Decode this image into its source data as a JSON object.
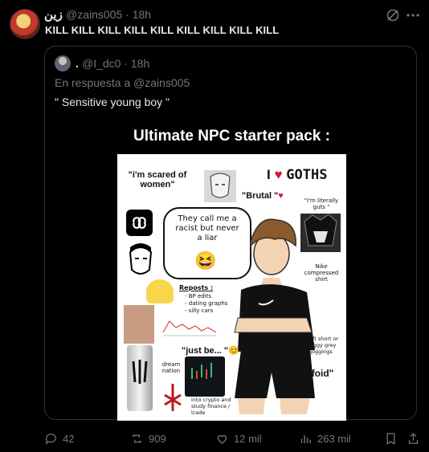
{
  "post": {
    "display_name": "زين",
    "handle_time": "@zains005 · 18h",
    "text": "KILL KILL KILL KILL KILL KILL KILL KILL KILL"
  },
  "quote": {
    "display_name": ".",
    "handle_time": "@I_dc0 · 18h",
    "reply_to": "En respuesta a @zains005",
    "text": "\" Sensitive young boy \"",
    "meme": {
      "title": "Ultimate NPC starter pack :",
      "scared": "\"i'm scared of women\"",
      "goths": "GOTHS",
      "brutal": "\"Brutal \"",
      "literally_guts": "\"I'm literally guts \"",
      "bubble": "They call me a racist but never a liar",
      "compressed": "Nike compressed shirt",
      "reposts_title": "Reposts :",
      "reposts_items": [
        "- BP edits",
        "- dating graphs",
        "- silly cars"
      ],
      "just_be": "\"just be... \"",
      "shorts": "10 ft short or baggy grey joggings",
      "dream_nation": "dream nation",
      "crypto": "into crypto and study finance / trade",
      "foid": "\"foid\""
    }
  },
  "actions": {
    "replies": "42",
    "reposts": "909",
    "likes": "12 mil",
    "views": "263 mil"
  },
  "colors": {
    "background": "#000000",
    "text": "#e7e9ea",
    "muted": "#71767b",
    "border": "#2f3336"
  }
}
